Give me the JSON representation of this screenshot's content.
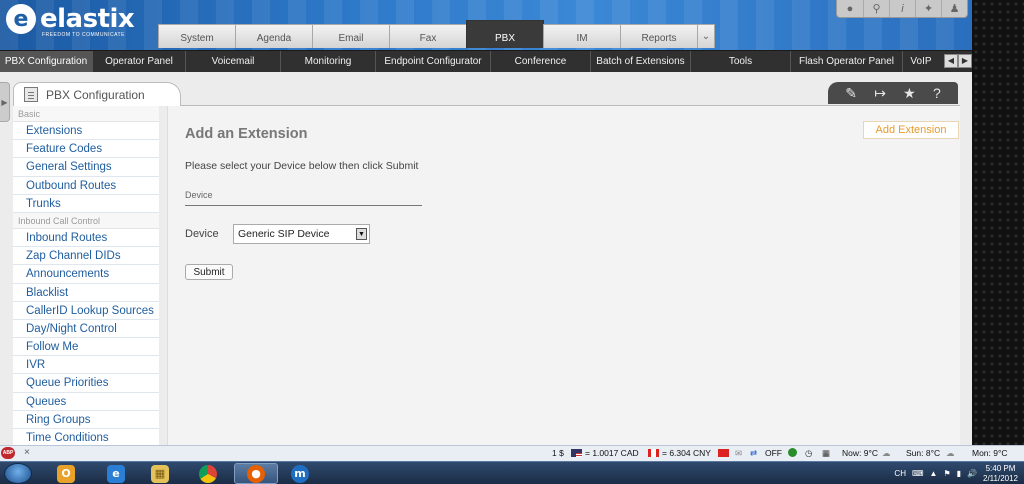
{
  "header": {
    "logo_text": "elastix",
    "logo_tagline": "FREEDOM TO COMMUNICATE",
    "tools": [
      "drop-icon",
      "search-icon",
      "info-icon",
      "puzzle-icon",
      "user-icon"
    ],
    "tabs": [
      "System",
      "Agenda",
      "Email",
      "Fax",
      "PBX",
      "IM",
      "Reports"
    ],
    "active_tab": "PBX"
  },
  "menu": {
    "items": [
      "PBX Configuration",
      "Operator Panel",
      "Voicemail",
      "Monitoring",
      "Endpoint Configurator",
      "Conference",
      "Batch of Extensions",
      "Tools",
      "Flash Operator Panel",
      "VoIP"
    ],
    "active": "PBX Configuration"
  },
  "module": {
    "tab_label": "PBX Configuration",
    "tools": [
      "edit-icon",
      "export-icon",
      "star-icon",
      "help-icon"
    ]
  },
  "sidebar": {
    "sections": [
      {
        "label": "Basic",
        "items": [
          "Extensions",
          "Feature Codes",
          "General Settings",
          "Outbound Routes",
          "Trunks"
        ]
      },
      {
        "label": "Inbound Call Control",
        "items": [
          "Inbound Routes",
          "Zap Channel DIDs",
          "Announcements",
          "Blacklist",
          "CallerID Lookup Sources",
          "Day/Night Control",
          "Follow Me",
          "IVR",
          "Queue Priorities",
          "Queues",
          "Ring Groups",
          "Time Conditions"
        ]
      }
    ]
  },
  "main": {
    "title": "Add an Extension",
    "instruction": "Please select your Device below then click Submit",
    "section_label": "Device",
    "device_label": "Device",
    "device_value": "Generic SIP Device",
    "submit_label": "Submit",
    "add_extension_link": "Add Extension"
  },
  "statusbar": {
    "abp_label": "ABP",
    "close": "×",
    "btc": "1 $",
    "usd_cad": "= 1.0017 CAD",
    "cad_cny": "= 6.304 CNY",
    "off": "OFF",
    "now_weather": "Now: 9°C",
    "sun_weather": "Sun: 8°C",
    "mon_weather": "Mon: 9°C"
  },
  "taskbar": {
    "apps": [
      "outlook-icon",
      "ie-icon",
      "explorer-icon",
      "chrome-icon",
      "firefox-icon",
      "app-icon"
    ],
    "lang": "CH",
    "time": "5:40 PM",
    "date": "2/11/2012"
  },
  "colors": {
    "header_blue": "#2d78c8",
    "menu_dark": "#303030",
    "link_blue": "#1f5d9e",
    "add_link_orange": "#e89a2e"
  }
}
